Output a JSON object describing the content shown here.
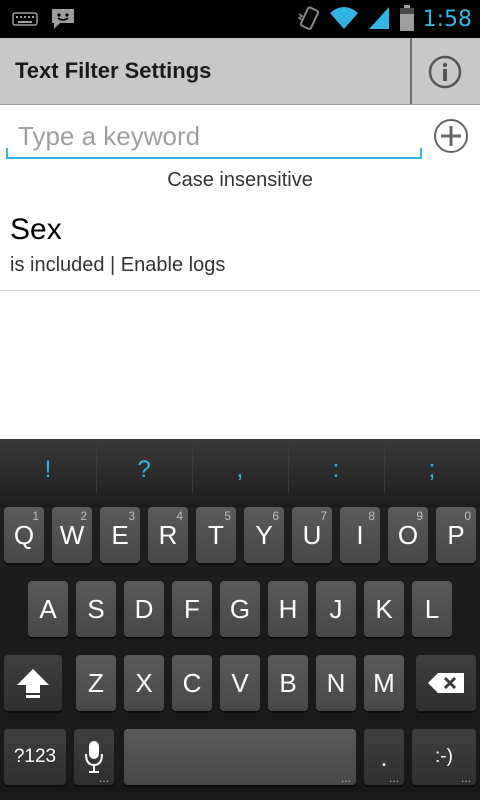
{
  "status_bar": {
    "time": "1:58",
    "icons": [
      "keyboard-icon",
      "chat-icon",
      "vibrate-icon",
      "wifi-icon",
      "signal-icon",
      "battery-icon"
    ],
    "accent_color": "#33b5e5"
  },
  "header": {
    "title": "Text Filter Settings",
    "info_icon": "info-icon"
  },
  "keyword": {
    "value": "",
    "placeholder": "Type a keyword",
    "add_icon": "add-circle-icon",
    "mode_label": "Case insensitive"
  },
  "filters": [
    {
      "name": "Sex",
      "description": "is included | Enable logs"
    }
  ],
  "keyboard": {
    "suggestions": [
      "!",
      "?",
      ",",
      ":",
      ";"
    ],
    "row1": [
      {
        "label": "Q",
        "hint": "1"
      },
      {
        "label": "W",
        "hint": "2"
      },
      {
        "label": "E",
        "hint": "3"
      },
      {
        "label": "R",
        "hint": "4"
      },
      {
        "label": "T",
        "hint": "5"
      },
      {
        "label": "Y",
        "hint": "6"
      },
      {
        "label": "U",
        "hint": "7"
      },
      {
        "label": "I",
        "hint": "8"
      },
      {
        "label": "O",
        "hint": "9"
      },
      {
        "label": "P",
        "hint": "0"
      }
    ],
    "row2": [
      "A",
      "S",
      "D",
      "F",
      "G",
      "H",
      "J",
      "K",
      "L"
    ],
    "row3": [
      "Z",
      "X",
      "C",
      "V",
      "B",
      "N",
      "M"
    ],
    "symbols_label": "?123",
    "period_label": ".",
    "smiley_label": ":-)",
    "more_dots": "...",
    "shift_icon": "shift-arrow-icon",
    "backspace_icon": "backspace-icon",
    "mic_icon": "microphone-icon"
  }
}
